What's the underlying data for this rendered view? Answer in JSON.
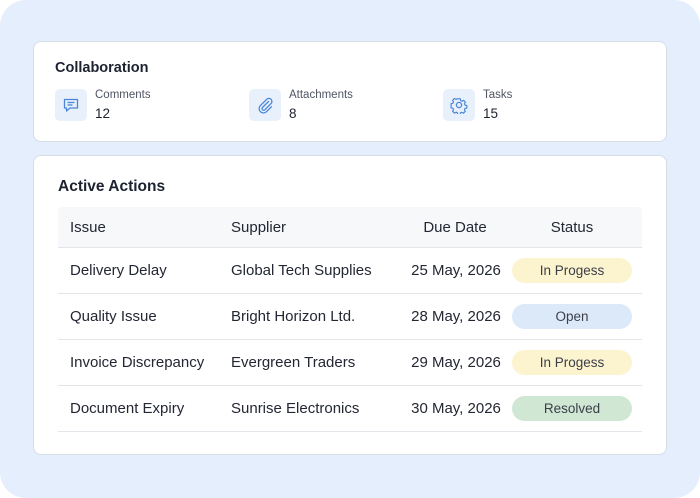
{
  "collaboration": {
    "title": "Collaboration",
    "stats": [
      {
        "label": "Comments",
        "value": "12",
        "icon": "comment-icon"
      },
      {
        "label": "Attachments",
        "value": "8",
        "icon": "paperclip-icon"
      },
      {
        "label": "Tasks",
        "value": "15",
        "icon": "gear-icon"
      }
    ]
  },
  "actions": {
    "title": "Active Actions",
    "columns": [
      "Issue",
      "Supplier",
      "Due Date",
      "Status"
    ],
    "rows": [
      {
        "issue": "Delivery Delay",
        "supplier": "Global Tech Supplies",
        "due": "25 May, 2026",
        "status": "In Progess",
        "status_color": "#fcf3cf"
      },
      {
        "issue": "Quality Issue",
        "supplier": "Bright Horizon Ltd.",
        "due": "28 May, 2026",
        "status": "Open",
        "status_color": "#dce9f9"
      },
      {
        "issue": "Invoice Discrepancy",
        "supplier": "Evergreen Traders",
        "due": "29 May, 2026",
        "status": "In Progess",
        "status_color": "#fcf3cf"
      },
      {
        "issue": "Document Expiry",
        "supplier": "Sunrise Electronics",
        "due": "30 May, 2026",
        "status": "Resolved",
        "status_color": "#cfe7d3"
      }
    ]
  },
  "colors": {
    "background": "#e4eefc",
    "icon_accent": "#4a86d9"
  }
}
